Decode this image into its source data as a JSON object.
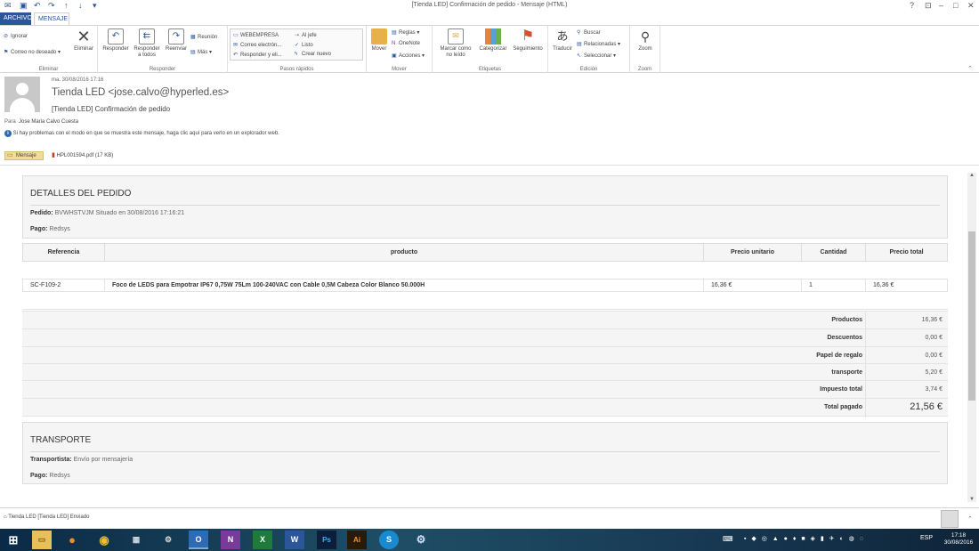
{
  "window": {
    "title": "[Tienda LED] Confirmación de pedido - Mensaje (HTML)",
    "help": "?",
    "min": "–",
    "max": "□",
    "close": "✕"
  },
  "tabs": {
    "archivo": "ARCHIVO",
    "mensaje": "MENSAJE"
  },
  "ribbon": {
    "eliminar": {
      "label": "Eliminar",
      "ignorar": "Ignorar",
      "correo_no_deseado": "Correo no deseado",
      "eliminar_btn": "Eliminar"
    },
    "responder": {
      "label": "Responder",
      "responder": "Responder",
      "responder_todos_1": "Responder",
      "responder_todos_2": "a todos",
      "reenviar": "Reenviar",
      "reunion": "Reunión",
      "mas": "Más"
    },
    "pasos": {
      "label": "Pasos rápidos",
      "webempresa": "WEBEMPRESA",
      "al_jefe": "Al jefe",
      "correo_elec": "Correo electrón...",
      "listo": "Listo",
      "responder_eli": "Responder y eli...",
      "crear_nuevo": "Crear nuevo"
    },
    "mover": {
      "label": "Mover",
      "mover": "Mover",
      "reglas": "Reglas",
      "onenote": "OneNote",
      "acciones": "Acciones"
    },
    "etiquetas": {
      "label": "Etiquetas",
      "marcar_1": "Marcar como",
      "marcar_2": "no leído",
      "categorizar": "Categorizar",
      "seguimiento": "Seguimiento"
    },
    "edicion": {
      "label": "Edición",
      "traducir": "Traducir",
      "buscar": "Buscar",
      "relacionadas": "Relacionadas",
      "seleccionar": "Seleccionar"
    },
    "zoom": {
      "label": "Zoom",
      "zoom": "Zoom"
    }
  },
  "header": {
    "date": "ma. 30/08/2016 17:16",
    "from": "Tienda LED <jose.calvo@hyperled.es>",
    "subject": "[Tienda LED] Confirmación de pedido",
    "to_label": "Para",
    "to": "Jose Maria Calvo Cuesta",
    "info": "Si hay problemas con el modo en que se muestra este mensaje, haga clic aquí para verlo en un explorador web.",
    "att_msg": "Mensaje",
    "att_pdf": "HPL001594.pdf (17 KB)"
  },
  "order": {
    "title": "DETALLES DEL PEDIDO",
    "pedido_label": "Pedido:",
    "pedido": "BVWHSTVJM Situado en 30/08/2016 17:16:21",
    "pago_label": "Pago:",
    "pago": "Redsys"
  },
  "table": {
    "headers": [
      "Referencia",
      "producto",
      "Precio unitario",
      "Cantidad",
      "Precio total"
    ],
    "row": {
      "ref": "SC-F109-2",
      "product": "Foco de LEDS para Empotrar IP67 0,75W 75Lm 100-240VAC con Cable 0,5M Cabeza Color Blanco 50.000H",
      "unit": "16,36 €",
      "qty": "1",
      "total": "16,36 €"
    }
  },
  "totals": [
    {
      "label": "Productos",
      "value": "16,36 €"
    },
    {
      "label": "Descuentos",
      "value": "0,00 €"
    },
    {
      "label": "Papel de regalo",
      "value": "0,00 €"
    },
    {
      "label": "transporte",
      "value": "5,20 €"
    },
    {
      "label": "Impuesto total",
      "value": "3,74 €"
    },
    {
      "label": "Total pagado",
      "value": "21,56 €"
    }
  ],
  "transport": {
    "title": "TRANSPORTE",
    "transportista_label": "Transportista:",
    "transportista": "Envío por mensajería",
    "pago_label": "Pago:",
    "pago": "Redsys"
  },
  "status": {
    "text": "Tienda LED [Tienda LED] Enviado"
  },
  "taskbar": {
    "lang": "ESP",
    "time": "17:18",
    "date": "30/08/2016"
  }
}
